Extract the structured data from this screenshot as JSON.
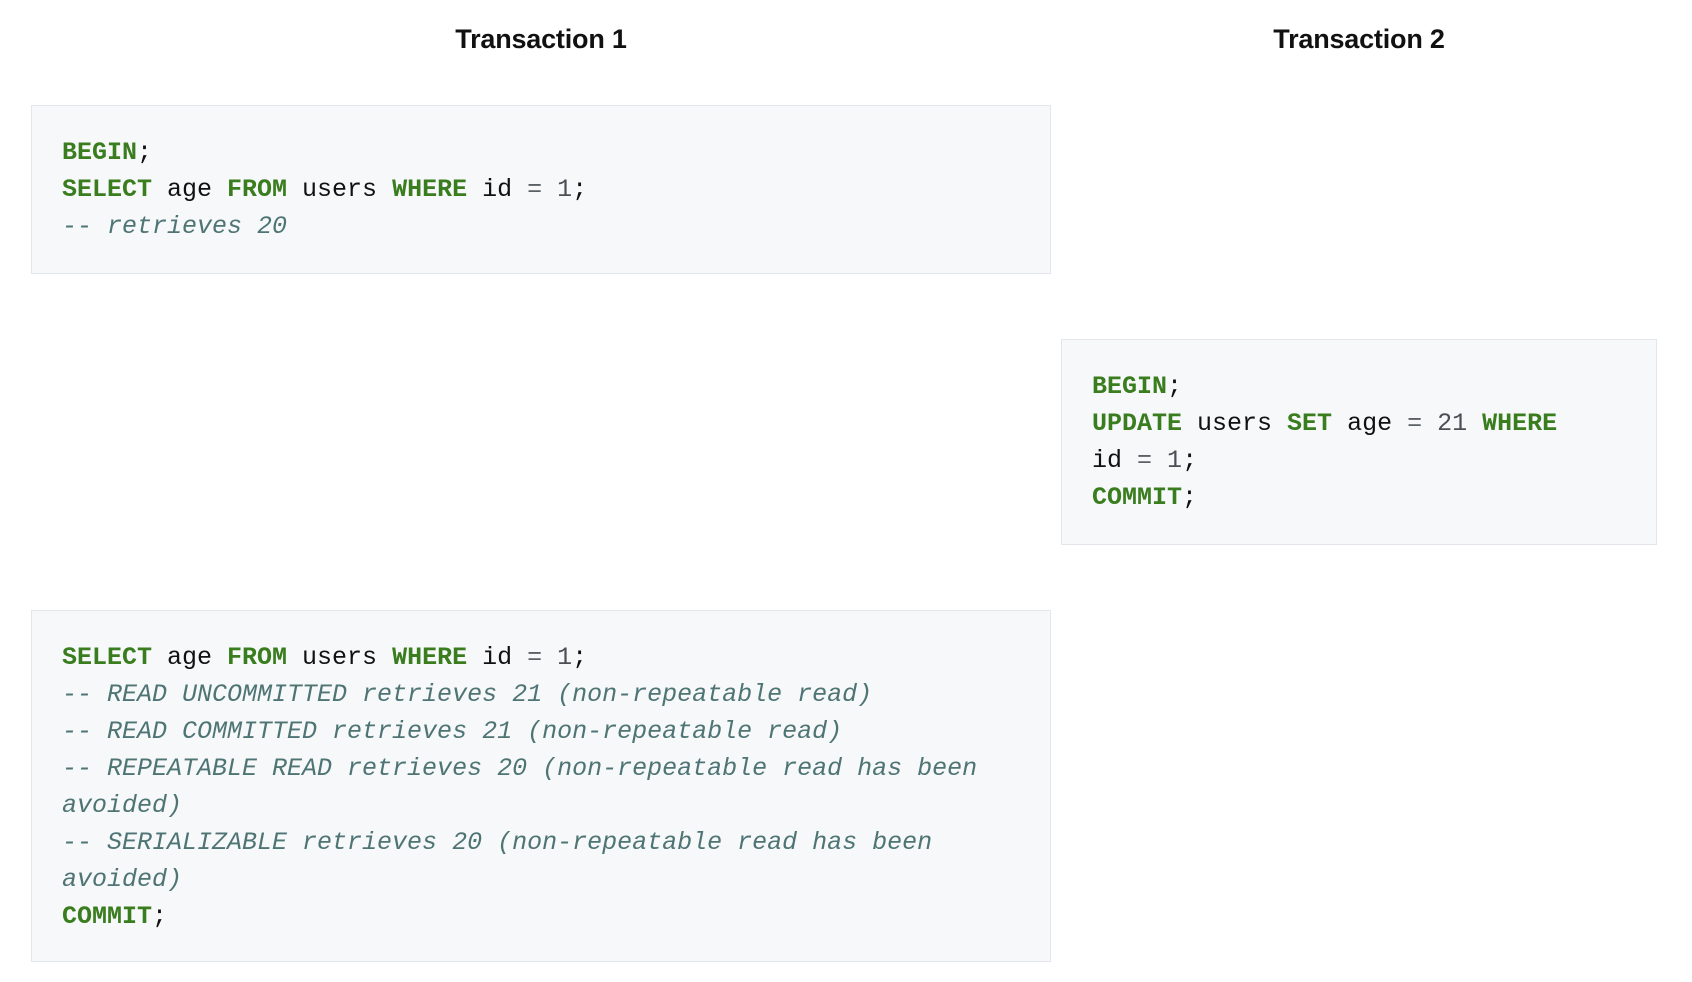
{
  "headers": {
    "transaction_1": "Transaction 1",
    "transaction_2": "Transaction 2"
  },
  "blocks": {
    "t1_begin": {
      "kw_begin": "BEGIN",
      "kw_select": "SELECT",
      "t_age": " age ",
      "kw_from": "FROM",
      "t_users": " users ",
      "kw_where": "WHERE",
      "t_id": " id ",
      "op_eq": "=",
      "num_1": "1",
      "semi": ";",
      "comment": "-- retrieves 20"
    },
    "t2_update": {
      "kw_begin": "BEGIN",
      "kw_update": "UPDATE",
      "t_users": " users ",
      "kw_set": "SET",
      "t_age": " age ",
      "op_eq": "=",
      "num_21": "21",
      "kw_where": "WHERE",
      "t_id": "id ",
      "num_1": "1",
      "kw_commit": "COMMIT",
      "semi": ";"
    },
    "t1_reread": {
      "kw_select": "SELECT",
      "t_age": " age ",
      "kw_from": "FROM",
      "t_users": " users ",
      "kw_where": "WHERE",
      "t_id": " id ",
      "op_eq": "=",
      "num_1": "1",
      "semi": ";",
      "comment_read_uncommitted": "-- READ UNCOMMITTED retrieves 21 (non-repeatable read)",
      "comment_read_committed": "-- READ COMMITTED retrieves 21 (non-repeatable read)",
      "comment_repeatable_read": "-- REPEATABLE READ retrieves 20 (non-repeatable read has been avoided)",
      "comment_serializable": "-- SERIALIZABLE retrieves 20 (non-repeatable read has been avoided)",
      "kw_commit": "COMMIT"
    }
  },
  "colors": {
    "keyword": "#3a7d1e",
    "comment": "#4f7474",
    "code_background": "#f6f8fa",
    "text": "#111111"
  }
}
